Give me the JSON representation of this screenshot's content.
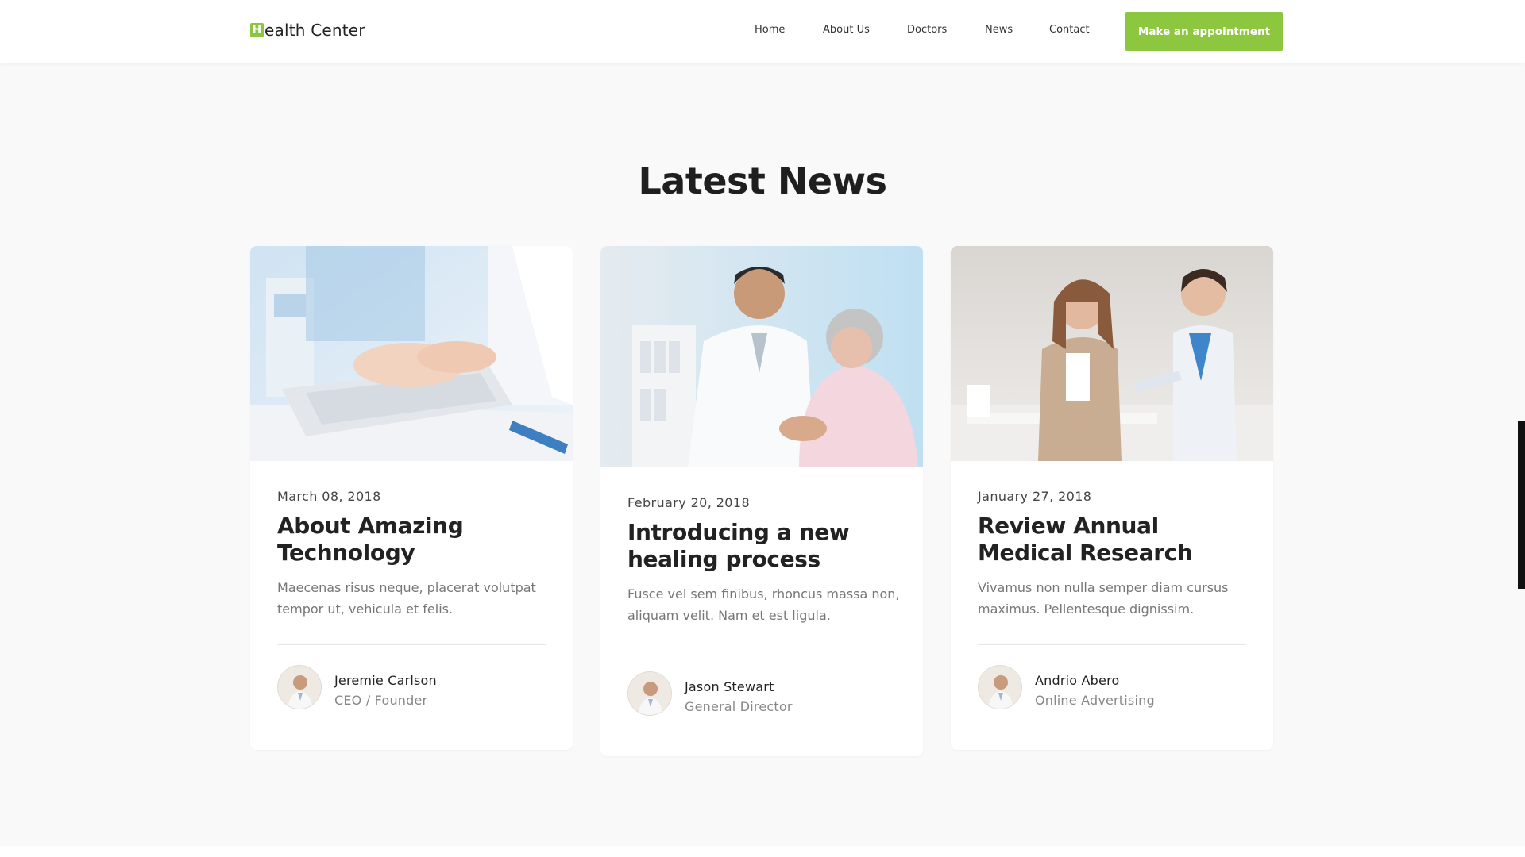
{
  "header": {
    "logo_letter": "H",
    "logo_text": "ealth Center",
    "nav": [
      "Home",
      "About Us",
      "Doctors",
      "News",
      "Contact"
    ],
    "cta_label": "Make an appointment"
  },
  "section": {
    "title": "Latest News"
  },
  "news": [
    {
      "date": "March 08, 2018",
      "title": "About Amazing Technology",
      "excerpt": "Maecenas risus neque, placerat volutpat tempor ut, vehicula et felis.",
      "author_name": "Jeremie Carlson",
      "author_role": "CEO / Founder"
    },
    {
      "date": "February 20, 2018",
      "title": "Introducing a new healing process",
      "excerpt": "Fusce vel sem finibus, rhoncus massa non, aliquam velit. Nam et est ligula.",
      "author_name": "Jason Stewart",
      "author_role": "General Director"
    },
    {
      "date": "January 27, 2018",
      "title": "Review Annual Medical Research",
      "excerpt": "Vivamus non nulla semper diam cursus maximus. Pellentesque dignissim.",
      "author_name": "Andrio Abero",
      "author_role": "Online Advertising"
    }
  ],
  "colors": {
    "accent": "#8dc63f",
    "background": "#f9f9f9",
    "heading": "#1f1f1f"
  }
}
